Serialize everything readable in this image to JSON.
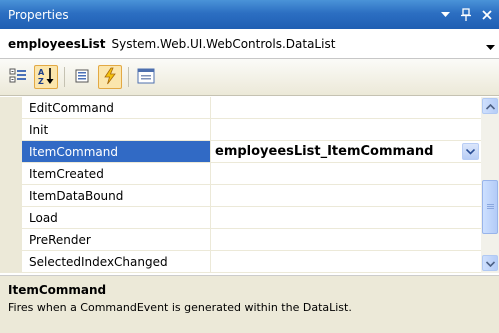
{
  "window": {
    "title": "Properties",
    "controls": [
      "dropdown-arrow-icon",
      "pin-icon",
      "close-icon"
    ]
  },
  "object_selector": {
    "name": "employeesList",
    "type": "System.Web.UI.WebControls.DataList"
  },
  "toolbar": {
    "buttons": [
      "categorized-icon",
      "alphabetical-icon",
      "properties-icon",
      "events-icon",
      "property-pages-icon"
    ],
    "active": [
      "alphabetical-icon",
      "events-icon"
    ]
  },
  "grid": {
    "rows": [
      {
        "name": "EditCommand",
        "value": ""
      },
      {
        "name": "Init",
        "value": ""
      },
      {
        "name": "ItemCommand",
        "value": "employeesList_ItemCommand"
      },
      {
        "name": "ItemCreated",
        "value": ""
      },
      {
        "name": "ItemDataBound",
        "value": ""
      },
      {
        "name": "Load",
        "value": ""
      },
      {
        "name": "PreRender",
        "value": ""
      },
      {
        "name": "SelectedIndexChanged",
        "value": ""
      }
    ],
    "selected_index": 2
  },
  "description": {
    "title": "ItemCommand",
    "text": "Fires when a CommandEvent is generated within the DataList."
  },
  "colors": {
    "titlebar": "#2c6fc2",
    "selection": "#316ac5",
    "chrome": "#ece9d8"
  }
}
